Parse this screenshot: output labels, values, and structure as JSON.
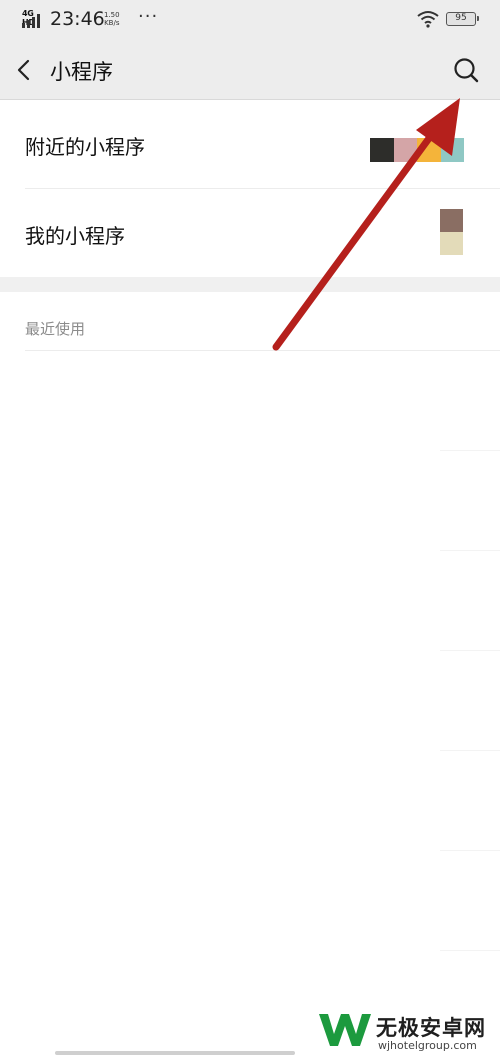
{
  "status_bar": {
    "network": "4G HD",
    "time": "23:46",
    "speed_value": "1.50",
    "speed_unit": "KB/s",
    "more": "···",
    "battery": "95"
  },
  "nav": {
    "title": "小程序"
  },
  "menu": {
    "items": [
      {
        "label": "附近的小程序"
      },
      {
        "label": "我的小程序"
      }
    ]
  },
  "recent": {
    "header": "最近使用"
  },
  "thumbnail_colors": {
    "nearby": [
      "#2d2d2a",
      "#d4a5a7",
      "#f4b43a",
      "#8fc8c4"
    ],
    "mine": [
      "#8a6e63",
      "#e3dbb9"
    ]
  },
  "annotation": {
    "arrow_color": "#b5201c"
  },
  "watermark": {
    "name": "无极安卓网",
    "url": "wjhotelgroup.com",
    "logo_color": "#1c9a3e"
  }
}
